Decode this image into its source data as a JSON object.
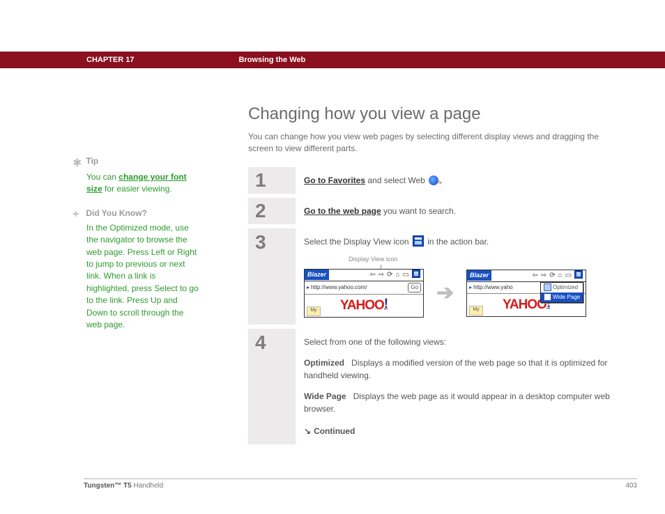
{
  "header": {
    "chapter": "CHAPTER 17",
    "title": "Browsing the Web"
  },
  "sidebar": {
    "tip": {
      "heading": "Tip",
      "prefix": "You can ",
      "link": "change your font size",
      "suffix": " for easier viewing."
    },
    "didyouknow": {
      "heading": "Did You Know?",
      "body": "In the Optimized mode, use the navigator to browse the web page. Press Left or Right to jump to previous or next link. When a link is highlighted, press Select to go to the link. Press Up and Down to scroll through the web page."
    }
  },
  "main": {
    "h1": "Changing how you view a page",
    "intro": "You can change how you view web pages by selecting different display views and dragging the screen to view different parts.",
    "steps": {
      "s1": {
        "num": "1",
        "link": "Go to Favorites",
        "rest": " and select Web "
      },
      "s2": {
        "num": "2",
        "link": "Go to the web page",
        "rest": " you want to search."
      },
      "s3": {
        "num": "3",
        "before": "Select the Display View icon ",
        "after": " in the action bar.",
        "figlabel": "Display View icon",
        "screens": {
          "appname": "Blazer",
          "url1": "http://www.yahoo.com/",
          "url2": "http://www.yaho",
          "go": "Go",
          "yahoo_main": "YAHOO",
          "yahoo_bang": "!",
          "my": "My",
          "menu_opt": "Optimized",
          "menu_wide": "Wide Page"
        }
      },
      "s4": {
        "num": "4",
        "lead": "Select from one of the following views:",
        "opt_label": "Optimized",
        "opt_desc": "Displays a modified version of the web page so that it is optimized for handheld viewing.",
        "wide_label": "Wide Page",
        "wide_desc": "Displays the web page as it would appear in a desktop computer web browser.",
        "continued": "Continued"
      }
    }
  },
  "footer": {
    "product_bold": "Tungsten™ T5",
    "product_rest": " Handheld",
    "page": "403"
  }
}
